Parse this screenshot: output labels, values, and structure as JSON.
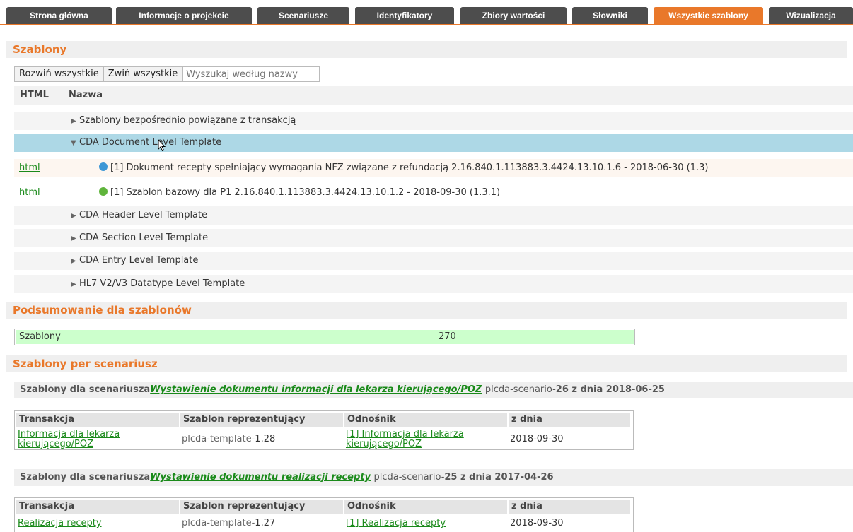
{
  "tabs": [
    {
      "label": "Strona główna",
      "active": false
    },
    {
      "label": "Informacje o projekcie",
      "active": false
    },
    {
      "label": "Scenariusze",
      "active": false
    },
    {
      "label": "Identyfikatory",
      "active": false
    },
    {
      "label": "Zbiory wartości",
      "active": false
    },
    {
      "label": "Słowniki",
      "active": false
    },
    {
      "label": "Wszystkie szablony",
      "active": true
    },
    {
      "label": "Wizualizacja",
      "active": false
    }
  ],
  "templates_section": {
    "title": "Szablony",
    "expand_all": "Rozwiń wszystkie",
    "collapse_all": "Zwiń wszystkie",
    "search_placeholder": "Wyszukaj według nazwy",
    "col_html": "HTML",
    "col_name": "Nazwa",
    "rows": [
      {
        "type": "group",
        "expanded": false,
        "label": "Szablony bezpośrednio powiązane z transakcją"
      },
      {
        "type": "group",
        "expanded": true,
        "selected": true,
        "label": "CDA Document Level Template"
      },
      {
        "type": "item",
        "link": "html",
        "status": "blue",
        "label": "[1] Dokument recepty spełniający wymagania NFZ związane z refundacją 2.16.840.1.113883.3.4424.13.10.1.6 - 2018-06-30 (1.3)"
      },
      {
        "type": "item",
        "link": "html",
        "status": "green",
        "label": "[1] Szablon bazowy dla P1 2.16.840.1.113883.3.4424.13.10.1.2 - 2018-09-30 (1.3.1)"
      },
      {
        "type": "group",
        "expanded": false,
        "label": "CDA Header Level Template"
      },
      {
        "type": "group",
        "expanded": false,
        "label": "CDA Section Level Template"
      },
      {
        "type": "group",
        "expanded": false,
        "label": "CDA Entry Level Template"
      },
      {
        "type": "group",
        "expanded": false,
        "label": "HL7 V2/V3 Datatype Level Template"
      }
    ]
  },
  "summary_section": {
    "title": "Podsumowanie dla szablonów",
    "label": "Szablony",
    "value": "270"
  },
  "per_scenario_section": {
    "title": "Szablony per scenariusz",
    "scenarios": [
      {
        "prefix": "Szablony dla scenariusza",
        "name": "Wystawienie dokumentu informacji dla lekarza kierującego/POZ",
        "id_prefix": "plcda-scenario-",
        "id_num": "26",
        "date_text": " z dnia 2018-06-25",
        "headers": [
          "Transakcja",
          "Szablon reprezentujący",
          "Odnośnik",
          "z dnia"
        ],
        "row": {
          "transaction": "Informacja dla lekarza kierującego/POZ",
          "template_prefix": "plcda-template-",
          "template_num": "1.28",
          "link": "[1] Informacja dla lekarza kierującego/POZ",
          "date": "2018-09-30"
        }
      },
      {
        "prefix": "Szablony dla scenariusza",
        "name": "Wystawienie dokumentu realizacji recepty",
        "id_prefix": "plcda-scenario-",
        "id_num": "25",
        "date_text": " z dnia 2017-04-26",
        "headers": [
          "Transakcja",
          "Szablon reprezentujący",
          "Odnośnik",
          "z dnia"
        ],
        "row": {
          "transaction": "Realizacja recepty",
          "template_prefix": "plcda-template-",
          "template_num": "1.27",
          "link": "[1] Realizacja recepty",
          "date": "2018-09-30"
        }
      }
    ]
  }
}
